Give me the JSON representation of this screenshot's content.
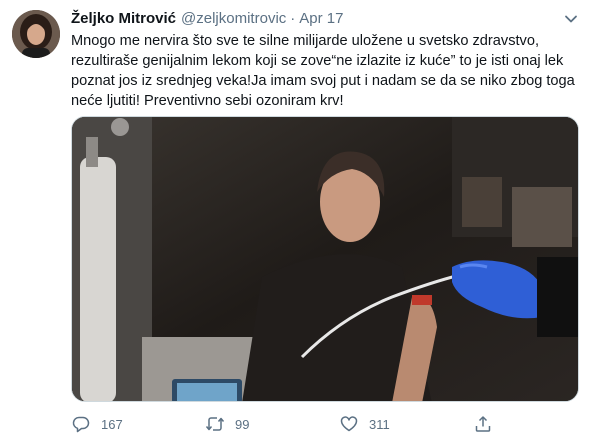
{
  "tweet": {
    "author_name": "Željko Mitrović",
    "handle": "@zeljkomitrovic",
    "separator": "·",
    "date": "Apr 17",
    "text": "Mnogo me nervira što sve te silne milijarde uložene u svetsko zdravstvo, rezultiraše genijalnim lekom koji se zove“ne izlazite iz kuće” to je isti onaj lek poznat jos iz srednjeg veka!Ja imam svoj put i nadam se da se niko zbog toga neće ljutiti! Preventivno sebi ozoniram krv!"
  },
  "actions": {
    "reply_count": "167",
    "retweet_count": "99",
    "like_count": "311"
  },
  "icons": {
    "caret": "chevron-down-icon",
    "reply": "reply-icon",
    "retweet": "retweet-icon",
    "like": "heart-icon",
    "share": "share-icon"
  },
  "colors": {
    "text": "#0f1419",
    "secondary": "#5b7083",
    "glove": "#2f5fd6"
  }
}
